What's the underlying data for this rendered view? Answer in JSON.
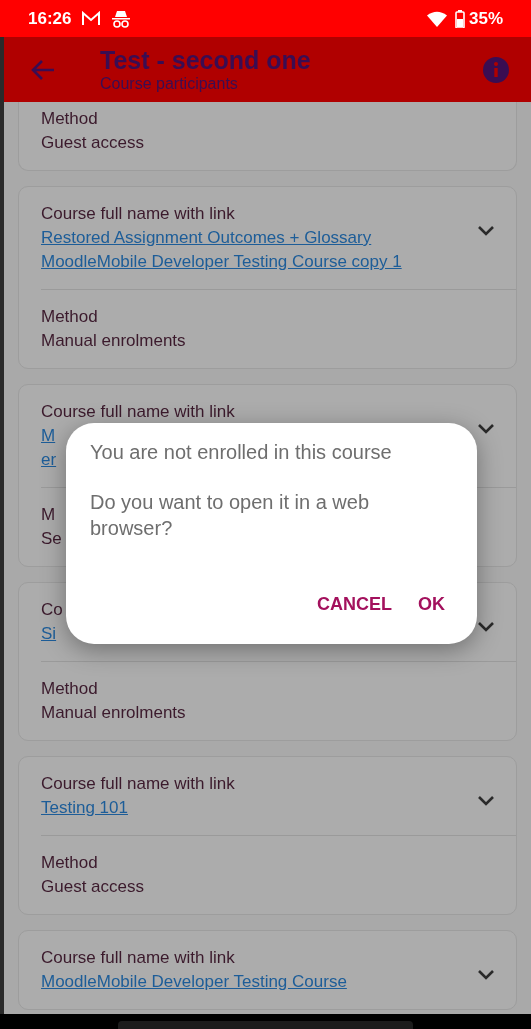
{
  "status_bar": {
    "time": "16:26",
    "battery": "35%"
  },
  "app_bar": {
    "title": "Test - second one",
    "subtitle": "Course participants"
  },
  "cards": [
    {
      "method": {
        "label": "Method",
        "value": "Guest access"
      }
    },
    {
      "course": {
        "label": "Course full name with link",
        "link_lines": [
          "Restored Assignment Outcomes + Glossary",
          "MoodleMobile Developer Testing Course copy 1"
        ]
      },
      "method": {
        "label": "Method",
        "value": "Manual enrolments"
      }
    },
    {
      "course": {
        "label": "Course full name with link",
        "link_lines": [
          "M",
          "er"
        ]
      },
      "method": {
        "label": "M",
        "value": "Se"
      }
    },
    {
      "course": {
        "label": "Co",
        "link_lines": [
          "Si"
        ]
      },
      "method": {
        "label": "Method",
        "value": "Manual enrolments"
      }
    },
    {
      "course": {
        "label": "Course full name with link",
        "link_lines": [
          "Testing 101"
        ]
      },
      "method": {
        "label": "Method",
        "value": "Guest access"
      }
    },
    {
      "course": {
        "label": "Course full name with link",
        "link_lines": [
          "MoodleMobile Developer Testing Course"
        ]
      }
    }
  ],
  "dialog": {
    "title": "You are not enrolled in this course",
    "message": "Do you want to open it in a web browser?",
    "buttons": [
      "CANCEL",
      "OK"
    ]
  }
}
